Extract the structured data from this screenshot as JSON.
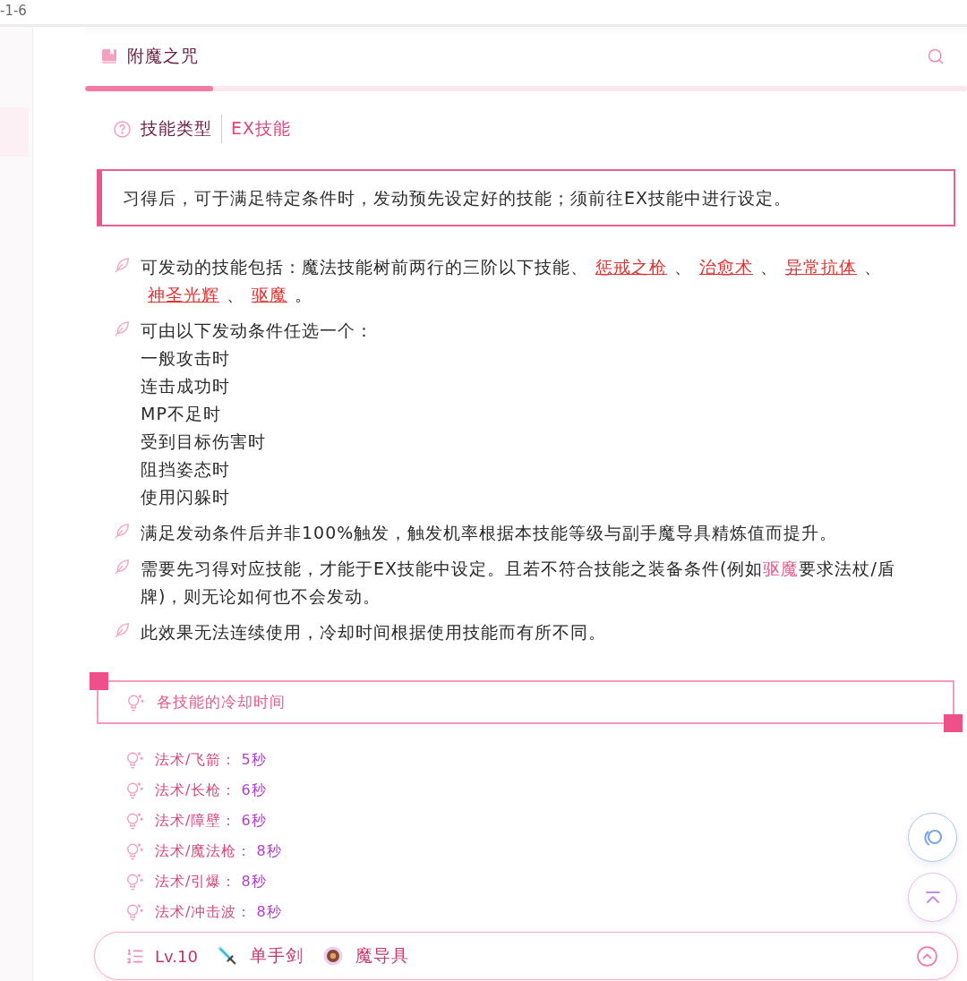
{
  "tab_strip": {
    "title": "-1-6"
  },
  "header": {
    "title": "附魔之咒",
    "progress": {
      "level": 0.145
    }
  },
  "skill_type": {
    "label": "技能类型",
    "value": "EX技能"
  },
  "summary": "习得后，可于满足特定条件时，发动预先设定好的技能；须前往EX技能中进行设定。",
  "notes": [
    {
      "segments": [
        {
          "kind": "text",
          "text": "可发动的技能包括：魔法技能树前两行的三阶以下技能、"
        },
        {
          "kind": "link",
          "text": "惩戒之枪"
        },
        {
          "kind": "text",
          "text": "、"
        },
        {
          "kind": "link",
          "text": "治愈术"
        },
        {
          "kind": "text",
          "text": "、"
        },
        {
          "kind": "link",
          "text": "异常抗体"
        },
        {
          "kind": "text",
          "text": "、"
        },
        {
          "kind": "link",
          "text": "神圣光辉"
        },
        {
          "kind": "text",
          "text": "、"
        },
        {
          "kind": "link",
          "text": "驱魔"
        },
        {
          "kind": "text",
          "text": "。"
        }
      ]
    },
    {
      "segments": [
        {
          "kind": "text",
          "text": "可由以下发动条件任选一个："
        }
      ],
      "lines": [
        "一般攻击时",
        "连击成功时",
        "MP不足时",
        "受到目标伤害时",
        "阻挡姿态时",
        "使用闪躲时"
      ]
    },
    {
      "segments": [
        {
          "kind": "text",
          "text": "满足发动条件后并非100%触发，触发机率根据本技能等级与副手魔导具精炼值而提升。"
        }
      ]
    },
    {
      "segments": [
        {
          "kind": "text",
          "text": "需要先习得对应技能，才能于EX技能中设定。且若不符合技能之装备条件(例如"
        },
        {
          "kind": "highlight",
          "text": "驱魔"
        },
        {
          "kind": "text",
          "text": "要求法杖/盾牌)，则无论如何也不会发动。"
        }
      ]
    },
    {
      "segments": [
        {
          "kind": "text",
          "text": "此效果无法连续使用，冷却时间根据使用技能而有所不同。"
        }
      ]
    }
  ],
  "cooldowns": {
    "title": "各技能的冷却时间",
    "items": [
      {
        "name": "法术/飞箭：",
        "time": "5秒"
      },
      {
        "name": "法术/长枪：",
        "time": "6秒"
      },
      {
        "name": "法术/障壁：",
        "time": "6秒"
      },
      {
        "name": "法术/魔法枪：",
        "time": "8秒"
      },
      {
        "name": "法术/引爆：",
        "time": "8秒"
      },
      {
        "name": "法术/冲击波：",
        "time": "8秒"
      }
    ]
  },
  "equipment_bar": {
    "level": "Lv.10",
    "items": [
      {
        "kind": "sword",
        "label": "单手剑"
      },
      {
        "kind": "orb",
        "label": "魔导具"
      }
    ]
  }
}
